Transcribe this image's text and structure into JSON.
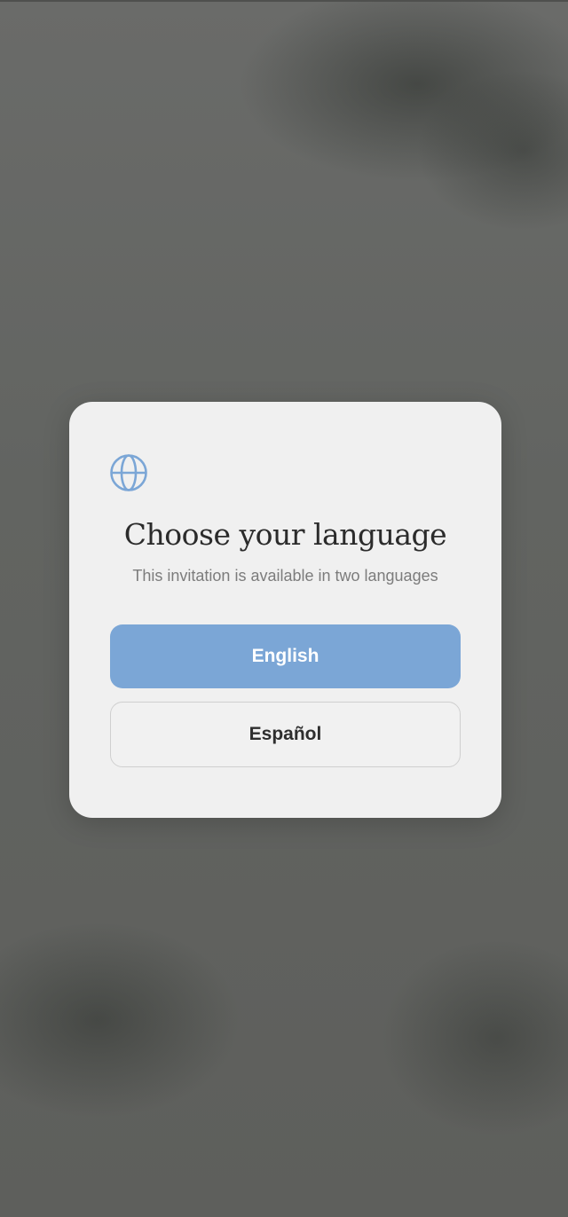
{
  "language_modal": {
    "icon": "globe-icon",
    "title": "Choose your language",
    "subtitle": "This invitation is available in two languages",
    "options": [
      {
        "label": "English",
        "selected": true
      },
      {
        "label": "Español",
        "selected": false
      }
    ]
  },
  "colors": {
    "accent": "#7ba6d6",
    "modal_background": "#f0f0f0",
    "overlay": "#5f605e",
    "title_text": "#2b2b2b",
    "subtitle_text": "#7c7c7c"
  }
}
